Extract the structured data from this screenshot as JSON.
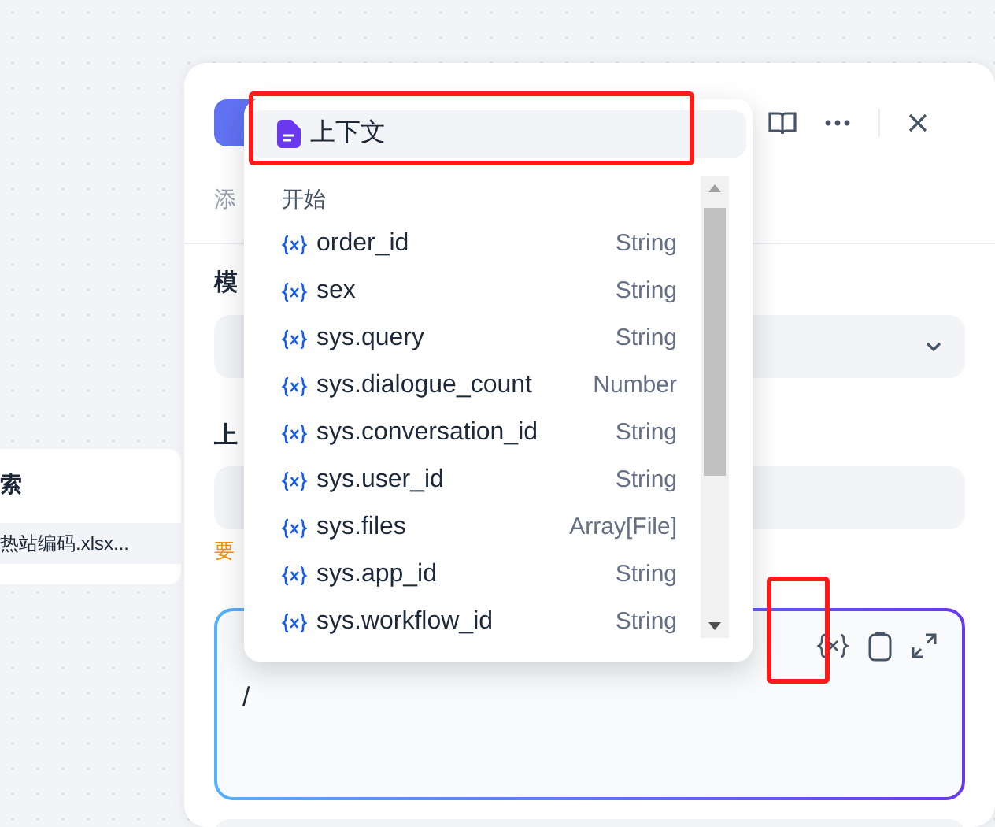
{
  "side_card": {
    "title": "索",
    "file": "热站编码.xlsx..."
  },
  "panel": {
    "description": "添",
    "model_label": "模",
    "context_label": "上",
    "context_hint": "要",
    "editor_text": "/"
  },
  "dropdown": {
    "header": {
      "label": "上下文",
      "selected": true
    },
    "group": "开始",
    "items": [
      {
        "name": "order_id",
        "type": "String"
      },
      {
        "name": "sex",
        "type": "String"
      },
      {
        "name": "sys.query",
        "type": "String"
      },
      {
        "name": "sys.dialogue_count",
        "type": "Number"
      },
      {
        "name": "sys.conversation_id",
        "type": "String"
      },
      {
        "name": "sys.user_id",
        "type": "String"
      },
      {
        "name": "sys.files",
        "type": "Array[File]"
      },
      {
        "name": "sys.app_id",
        "type": "String"
      },
      {
        "name": "sys.workflow_id",
        "type": "String"
      }
    ]
  }
}
